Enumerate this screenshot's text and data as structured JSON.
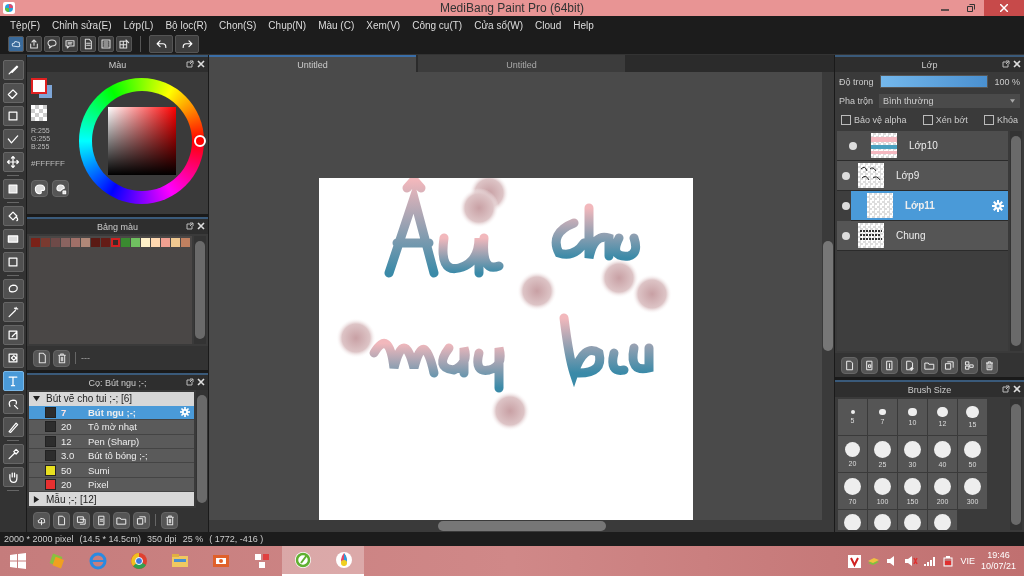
{
  "window": {
    "title": "MediBang Paint Pro (64bit)"
  },
  "menu": [
    "Tệp(F)",
    "Chỉnh sửa(E)",
    "Lớp(L)",
    "Bộ lọc(R)",
    "Chọn(S)",
    "Chụp(N)",
    "Màu (C)",
    "Xem(V)",
    "Công cụ(T)",
    "Cửa sổ(W)",
    "Cloud",
    "Help"
  ],
  "tools": [
    {
      "selected": false
    },
    {
      "selected": false
    },
    {
      "selected": false
    },
    {
      "selected": false
    },
    {
      "selected": false
    },
    {
      "selected": false
    },
    {
      "selected": false
    },
    {
      "selected": false
    },
    {
      "selected": false
    },
    {
      "selected": false
    },
    {
      "selected": false
    },
    {
      "selected": false
    },
    {
      "selected": false
    },
    {
      "selected": true
    },
    {
      "selected": false
    },
    {
      "selected": false
    },
    {
      "selected": false
    },
    {
      "selected": false
    }
  ],
  "color_panel": {
    "title": "Màu",
    "r": "R:255",
    "g": "G:255",
    "b": "B:255",
    "hex": "#FFFFFF"
  },
  "palette_panel": {
    "title": "Bảng màu",
    "footer": "---",
    "swatches": [
      {
        "color": "#7a2218",
        "selected": false
      },
      {
        "color": "#7a3a30",
        "selected": false
      },
      {
        "color": "#6e4a48",
        "selected": false
      },
      {
        "color": "#8a6460",
        "selected": false
      },
      {
        "color": "#a07068",
        "selected": false
      },
      {
        "color": "#b08878",
        "selected": false
      },
      {
        "color": "#5a1a14",
        "selected": false
      },
      {
        "color": "#641c16",
        "selected": false
      },
      {
        "color": "#3a2a28",
        "selected": true
      },
      {
        "color": "#3a8a30",
        "selected": false
      },
      {
        "color": "#70c060",
        "selected": false
      },
      {
        "color": "#fff0c8",
        "selected": false
      },
      {
        "color": "#ffd8b0",
        "selected": false
      },
      {
        "color": "#f0a090",
        "selected": false
      },
      {
        "color": "#f0c890",
        "selected": false
      },
      {
        "color": "#c08060",
        "selected": false
      }
    ]
  },
  "brush_panel": {
    "title": "Cọ: Bút ngu ;-;",
    "groups": [
      {
        "label": "Bút vẽ cho tui ;-; [6]",
        "expanded": true,
        "brushes": [
          {
            "size": "7",
            "name": "Bút ngu ;-;",
            "color": "#2d2d2d",
            "selected": true
          },
          {
            "size": "20",
            "name": "Tô mờ nhạt",
            "color": "#2d2d2d",
            "selected": false
          },
          {
            "size": "12",
            "name": "Pen (Sharp)",
            "color": "#2d2d2d",
            "selected": false
          },
          {
            "size": "3.0",
            "name": "Bút tô bóng ;-;",
            "color": "#2d2d2d",
            "selected": false
          },
          {
            "size": "50",
            "name": "Sumi",
            "color": "#e8e020",
            "selected": false
          },
          {
            "size": "20",
            "name": "Pixel",
            "color": "#e83030",
            "selected": false
          }
        ]
      },
      {
        "label": "Mẫu ;-; [12]",
        "expanded": false
      }
    ]
  },
  "tabs": [
    {
      "label": "Untitled",
      "selected": true
    },
    {
      "label": "Untitled",
      "selected": false
    }
  ],
  "layer_panel": {
    "title": "Lớp",
    "opacity_label": "Độ trong",
    "level": 1.0,
    "opacity_value": "100 %",
    "blend_label": "Pha trộn",
    "blend_value": "Bình thường",
    "options": [
      {
        "label": "Bảo vệ alpha",
        "checked": false
      },
      {
        "label": "Xén bớt",
        "checked": false
      },
      {
        "label": "Khóa",
        "checked": false
      }
    ],
    "layers": [
      {
        "name": "Lớp10",
        "selected": false,
        "clipped": true
      },
      {
        "name": "Lớp9",
        "selected": false,
        "clipped": false
      },
      {
        "name": "Lớp11",
        "selected": true,
        "clipped": false
      },
      {
        "name": "Chung",
        "selected": false,
        "clipped": false
      }
    ]
  },
  "brush_size_panel": {
    "title": "Brush Size",
    "sizes": [
      "5",
      "7",
      "10",
      "12",
      "15",
      "20",
      "25",
      "30",
      "40",
      "50",
      "70",
      "100",
      "150",
      "200",
      "300"
    ]
  },
  "status_bar": {
    "pixels": "2000 * 2000 pixel",
    "physical": "(14.5 * 14.5cm)",
    "dpi": "350 dpi",
    "zoom": "25 %",
    "position": "( 1772, -416 )"
  },
  "taskbar": {
    "apps": [
      {
        "selected": false
      },
      {
        "selected": false
      },
      {
        "selected": false
      },
      {
        "selected": false
      },
      {
        "selected": false
      },
      {
        "selected": false
      },
      {
        "selected": true
      },
      {
        "selected": true
      }
    ],
    "language": "VIE",
    "time": "19:46",
    "date": "10/07/21"
  }
}
